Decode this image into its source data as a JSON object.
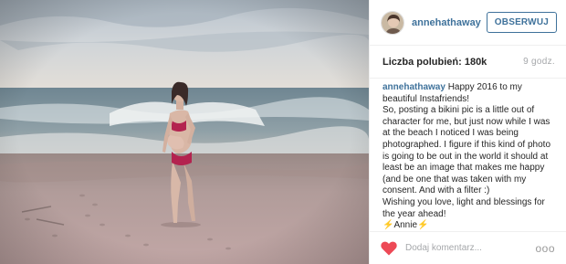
{
  "post": {
    "image_alt": "Woman in pink bikini standing on a beach at dusk"
  },
  "header": {
    "username": "annehathaway",
    "follow_label": "OBSERWUJ"
  },
  "stats": {
    "likes": "Liczba polubień: 180k",
    "time": "9 godz."
  },
  "caption": {
    "author": "annehathaway",
    "text": " Happy 2016 to my beautiful Instafriends!\nSo, posting a bikini pic is a little out of character for me, but just now while I was at the beach I noticed I was being photographed. I figure if this kind of photo is going to be out in the world it should at least be an image that makes me happy (and be one that was taken with my consent. And with a filter :)\nWishing you love, light and blessings for the year ahead!\n⚡️Annie⚡️"
  },
  "footer": {
    "comment_placeholder": "Dodaj komentarz...",
    "more_label": "ooo"
  },
  "colors": {
    "link": "#3f729b",
    "heart": "#ed4956",
    "muted": "#a5a7aa"
  },
  "icons": {
    "like": "heart-icon",
    "options": "more-options-icon"
  }
}
